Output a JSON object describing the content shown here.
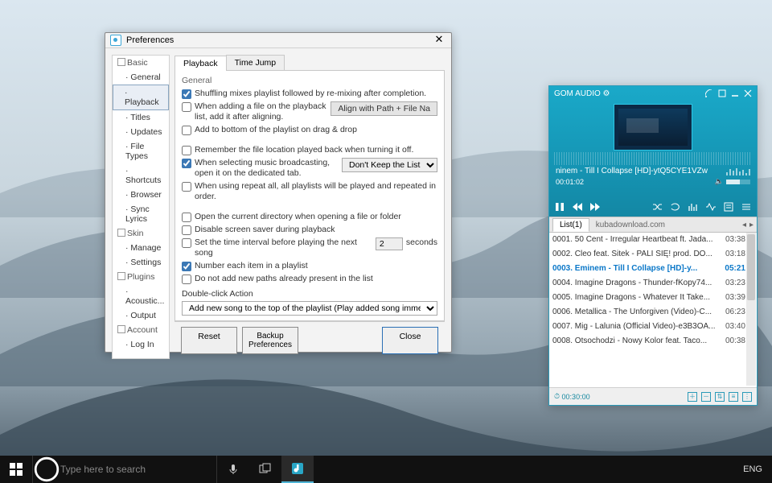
{
  "preferences": {
    "title": "Preferences",
    "sidebar": {
      "groups": [
        {
          "icon": "basic",
          "label": "Basic",
          "items": [
            "General",
            "Playback",
            "Titles",
            "Updates",
            "File Types",
            "Shortcuts",
            "Browser",
            "Sync Lyrics"
          ],
          "selected": "Playback"
        },
        {
          "icon": "skin",
          "label": "Skin",
          "items": [
            "Manage",
            "Settings"
          ]
        },
        {
          "icon": "plugins",
          "label": "Plugins",
          "items": [
            "Acoustic...",
            "Output"
          ]
        },
        {
          "icon": "account",
          "label": "Account",
          "items": [
            "Log In"
          ]
        }
      ]
    },
    "tabs": [
      "Playback",
      "Time Jump"
    ],
    "selected_tab": "Playback",
    "section_title": "General",
    "options": [
      {
        "checked": true,
        "label": "Shuffling mixes playlist followed by re-mixing after completion."
      },
      {
        "checked": false,
        "label": "When adding a file on the playback list, add it after aligning.",
        "trailing_button": "Align with Path + File Na"
      },
      {
        "checked": false,
        "label": "Add to bottom of the playlist on drag & drop"
      },
      {
        "checked": false,
        "label": "Remember the file location played back when turning it off.",
        "gap_before": true
      },
      {
        "checked": true,
        "label": "When selecting music broadcasting, open it on the dedicated tab.",
        "trailing_select": "Don't Keep the List"
      },
      {
        "checked": false,
        "label": "When using repeat all, all playlists will be played and repeated in order."
      },
      {
        "checked": false,
        "label": "Open the current directory when opening a file or folder",
        "gap_before": true
      },
      {
        "checked": false,
        "label": "Disable screen saver during playback"
      },
      {
        "checked": false,
        "label": "Set the time interval before playing the next song",
        "trailing_number": 2,
        "trailing_text": "seconds"
      },
      {
        "checked": true,
        "label": "Number each item in a playlist"
      },
      {
        "checked": false,
        "label": "Do not add new paths already present in the list"
      }
    ],
    "doubleclick": {
      "label": "Double-click Action",
      "value": "Add new song to the top of the playlist (Play added song immediately)"
    },
    "buttons": {
      "reset": "Reset",
      "backup": "Backup Preferences",
      "close": "Close"
    }
  },
  "gom": {
    "app_title": "GOM AUDIO ⚙",
    "now_playing": "ninem - Till I Collapse [HD]-ytQ5CYE1VZw",
    "elapsed": "00:01:02",
    "bottom_time": "00:30:00",
    "list_tab": "List(1)",
    "list_sub": "kubadownload.com",
    "playlist": [
      {
        "title": "0001. 50 Cent - Irregular Heartbeat ft. Jada...",
        "dur": "03:38"
      },
      {
        "title": "0002. Cleo feat. Sitek - PALI SIĘ! prod. DO...",
        "dur": "03:18"
      },
      {
        "title": "0003. Eminem - Till I Collapse [HD]-y...",
        "dur": "05:21",
        "current": true
      },
      {
        "title": "0004. Imagine Dragons - Thunder-fKopy74...",
        "dur": "03:23"
      },
      {
        "title": "0005. Imagine Dragons - Whatever It Take...",
        "dur": "03:39"
      },
      {
        "title": "0006. Metallica - The Unforgiven (Video)-C...",
        "dur": "06:23"
      },
      {
        "title": "0007. Mig - Lalunia (Official Video)-e3B3OA...",
        "dur": "03:40"
      },
      {
        "title": "0008. Otsochodzi - Nowy Kolor feat. Taco...",
        "dur": "00:38"
      }
    ]
  },
  "taskbar": {
    "search_placeholder": "Type here to search",
    "language": "ENG"
  }
}
